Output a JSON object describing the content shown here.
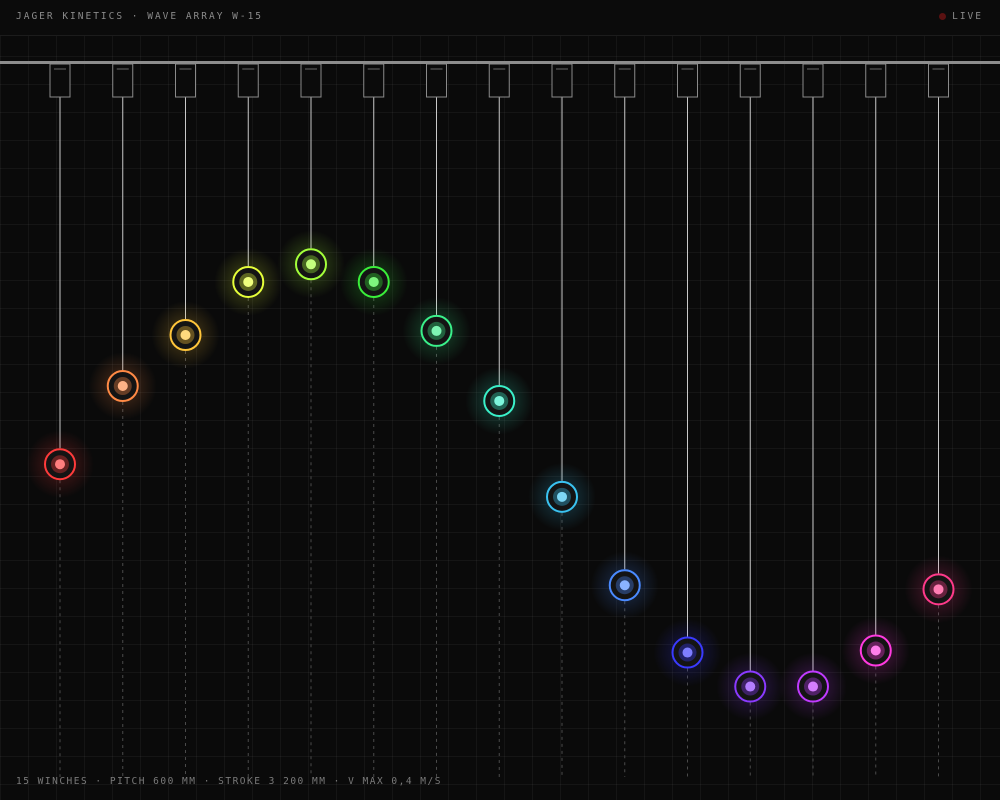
{
  "header": {
    "title": "JAGER KINETICS · WAVE ARRAY W-15",
    "status_label": "LIVE"
  },
  "footer": {
    "specs": "15 WINCHES · PITCH 600 MM · STROKE 3 200 MM · V MAX 0,4 M/S"
  },
  "winches": [
    {
      "color": "#ff3b3b",
      "level": 0.54
    },
    {
      "color": "#ff8a45",
      "level": 0.425
    },
    {
      "color": "#ffc53a",
      "level": 0.35
    },
    {
      "color": "#e6ff3a",
      "level": 0.272
    },
    {
      "color": "#a3ff3a",
      "level": 0.246
    },
    {
      "color": "#3aef3a",
      "level": 0.272
    },
    {
      "color": "#3af08a",
      "level": 0.344
    },
    {
      "color": "#3af0c9",
      "level": 0.447
    },
    {
      "color": "#3ac2f0",
      "level": 0.588
    },
    {
      "color": "#4a8aff",
      "level": 0.718
    },
    {
      "color": "#3a3aff",
      "level": 0.817
    },
    {
      "color": "#8a3aff",
      "level": 0.867
    },
    {
      "color": "#c03aff",
      "level": 0.867
    },
    {
      "color": "#ff3ae0",
      "level": 0.814
    },
    {
      "color": "#ff3a8a",
      "level": 0.724
    }
  ]
}
